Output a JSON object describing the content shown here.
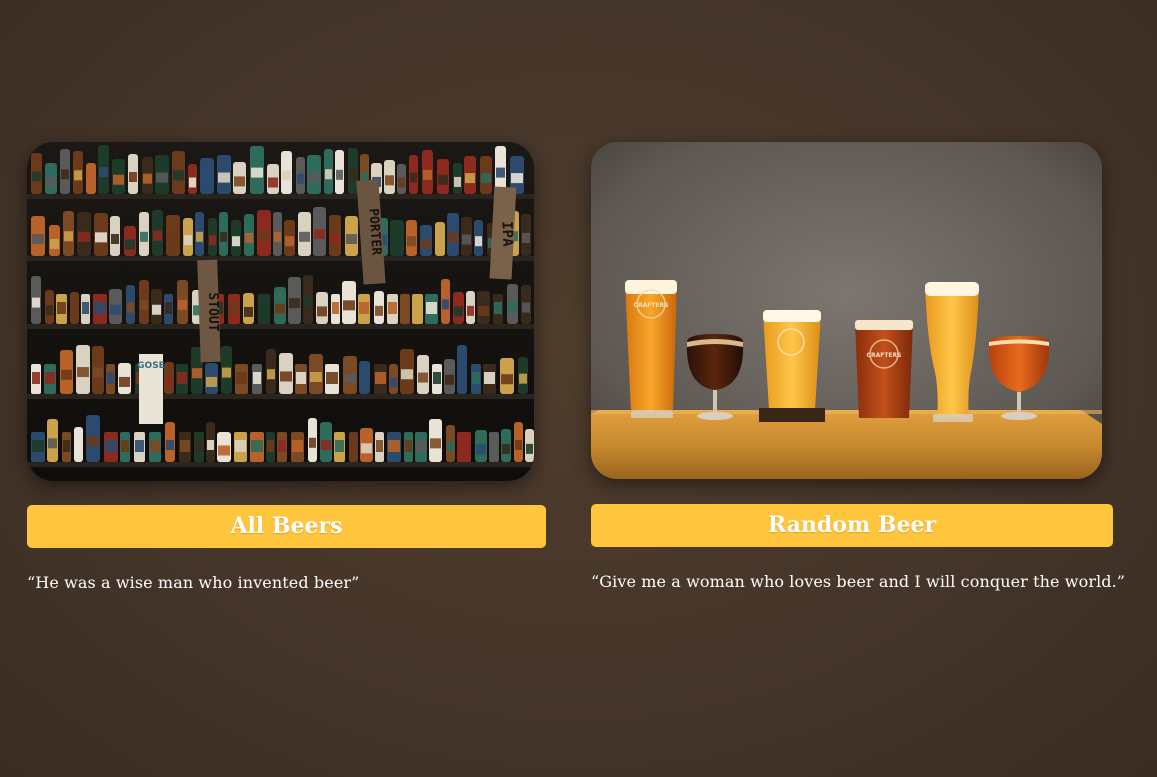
{
  "cards": [
    {
      "image_alt": "Shelves of beer bottles and cans",
      "shelf_signs": [
        "STOUT",
        "PORTER",
        "IPA",
        "GOSE"
      ],
      "button_label": "All Beers",
      "quote": "“He was a wise man who invented beer”"
    },
    {
      "image_alt": "Six glasses of craft beer on a wooden bar",
      "glass_logo": "CRAFTERS",
      "button_label": "Random Beer",
      "quote": "“Give me a woman who loves beer and I will conquer the world.”"
    }
  ],
  "colors": {
    "button_bg": "#ffc53d",
    "button_text": "#ffffff",
    "page_bg": "#45352a",
    "quote_text": "#ffffff"
  }
}
